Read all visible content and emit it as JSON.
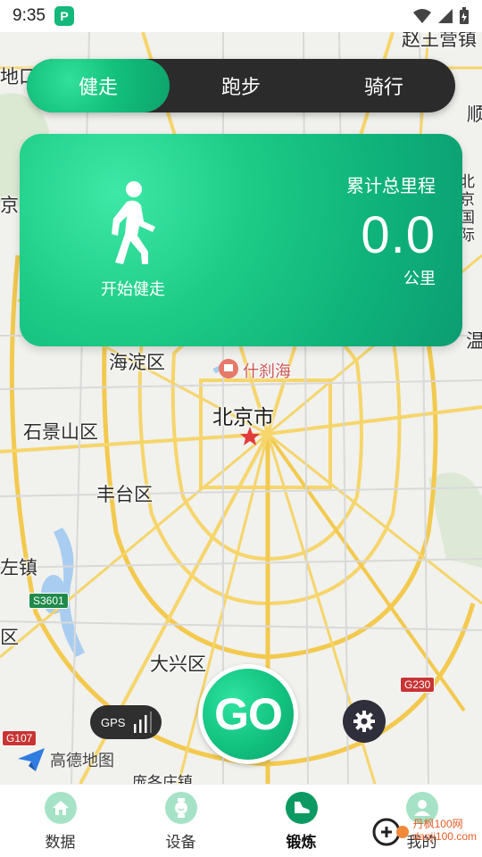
{
  "status_bar": {
    "time": "9:35",
    "app_icon": "P",
    "wifi_icon": "wifi-icon",
    "signal_icon": "signal-icon",
    "battery_icon": "battery-icon"
  },
  "mode_tabs": {
    "items": [
      "健走",
      "跑步",
      "骑行"
    ],
    "active": "健走"
  },
  "summary_card": {
    "start_label": "开始健走",
    "total_label": "累计总里程",
    "distance_value": "0.0",
    "distance_unit": "公里",
    "icon": "walking-person-icon"
  },
  "map": {
    "district_labels": [
      "海淀区",
      "石景山区",
      "丰台区",
      "大兴区"
    ],
    "city_label": "北京市",
    "poi_label": "什刹海",
    "edge_labels": [
      "赵王营镇",
      "地口",
      "京",
      "区",
      "顺",
      "北京国际",
      "温",
      "左镇",
      "区",
      "庞各庄镇"
    ],
    "road_tags": [
      "S3601",
      "G230",
      "G107"
    ],
    "provider_logo": "高德地图"
  },
  "controls": {
    "gps_label": "GPS",
    "go_label": "GO",
    "settings_icon": "gear-icon"
  },
  "bottom_nav": {
    "items": [
      {
        "label": "数据",
        "icon": "home-icon"
      },
      {
        "label": "设备",
        "icon": "watch-icon"
      },
      {
        "label": "锻炼",
        "icon": "shoe-icon"
      },
      {
        "label": "我的",
        "icon": "user-icon"
      }
    ],
    "active": "锻炼"
  },
  "watermark": {
    "line1": "丹枫100网",
    "line2": "danji100.com"
  },
  "colors": {
    "accent": "#12c07c",
    "dark": "#2b2b2b",
    "nav_active": "#0d9a62",
    "road": "#f6d56b"
  }
}
